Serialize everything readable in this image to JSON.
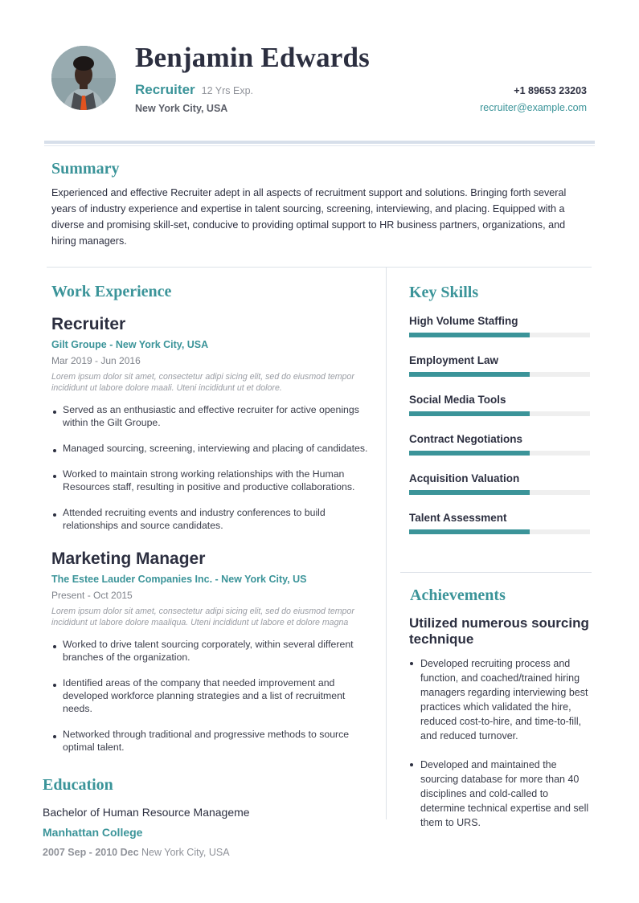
{
  "header": {
    "name": "Benjamin Edwards",
    "role": "Recruiter",
    "experience": "12 Yrs Exp.",
    "location": "New York City, USA",
    "phone": "+1 89653 23203",
    "email": "recruiter@example.com",
    "avatar_icon": "profile-photo"
  },
  "summary": {
    "title": "Summary",
    "text": "Experienced and effective Recruiter adept in all aspects of recruitment support and solutions. Bringing forth several years of industry experience and expertise in talent sourcing, screening, interviewing, and placing. Equipped with a diverse and promising skill-set, conducive to providing optimal support to HR business partners, organizations, and hiring managers."
  },
  "work": {
    "title": "Work Experience",
    "jobs": [
      {
        "title": "Recruiter",
        "company": "Gilt Groupe - New York City, USA",
        "date": "Mar 2019 - Jun 2016",
        "description": "Lorem ipsum dolor sit amet, consectetur adipi sicing elit, sed do eiusmod tempor incididunt ut labore dolore maali. Uteni incididunt ut et dolore.",
        "bullets": [
          "Served as an enthusiastic and effective recruiter for active openings within the Gilt Groupe.",
          "Managed sourcing, screening, interviewing and placing of candidates.",
          "Worked to maintain strong working relationships with the Human Resources staff, resulting in positive and productive collaborations.",
          "Attended recruiting events and industry conferences to build relationships and source candidates."
        ]
      },
      {
        "title": "Marketing Manager",
        "company": "The Estee Lauder Companies Inc. - New York City, US",
        "date": "Present - Oct 2015",
        "description": "Lorem ipsum dolor sit amet, consectetur adipi sicing elit, sed do eiusmod tempor incididunt ut labore dolore maaliqua. Uteni incididunt ut labore et dolore magna",
        "bullets": [
          "Worked to drive talent sourcing corporately, within several different branches of the organization.",
          "Identified areas of the company that needed improvement and developed workforce planning strategies and a list of recruitment needs.",
          "Networked through traditional and progressive methods to source optimal talent."
        ]
      }
    ]
  },
  "education": {
    "title": "Education",
    "degree": "Bachelor of Human Resource Management",
    "school": "Manhattan College",
    "date": "2007 Sep - 2010 Dec",
    "location": "New York City, USA"
  },
  "skills": {
    "title": "Key Skills",
    "items": [
      {
        "name": "High Volume Staffing",
        "level": 0.667
      },
      {
        "name": "Employment Law",
        "level": 0.667
      },
      {
        "name": "Social Media Tools",
        "level": 0.667
      },
      {
        "name": "Contract Negotiations",
        "level": 0.667
      },
      {
        "name": "Acquisition Valuation",
        "level": 0.667
      },
      {
        "name": "Talent Assessment",
        "level": 0.667
      }
    ]
  },
  "achievements": {
    "title": "Achievements",
    "headline": "Utilized numerous sourcing technique",
    "bullets": [
      "Developed recruiting process and function, and coached/trained hiring managers regarding interviewing best practices which validated the hire, reduced cost-to-hire, and time-to-fill, and reduced turnover.",
      "Developed and maintained the sourcing database for more than 40 disciplines and cold-called to determine technical expertise and sell them to URS."
    ]
  },
  "colors": {
    "accent": "#3b9499",
    "text": "#2c2f40",
    "muted": "#8f9299",
    "rule": "#dde2e8"
  }
}
